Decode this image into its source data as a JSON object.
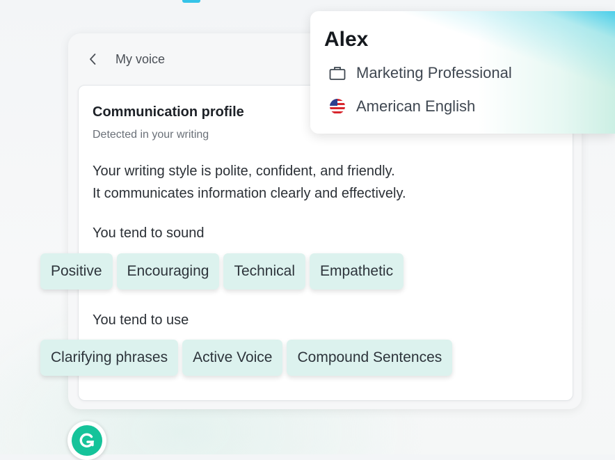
{
  "nav": {
    "back_icon": "chevron-left-icon",
    "back_label": "My voice"
  },
  "profile": {
    "title": "Communication profile",
    "subtitle": "Detected in your writing",
    "description_line1": "Your writing style is polite, confident, and friendly.",
    "description_line2": "It communicates information clearly and effectively."
  },
  "tones": {
    "label": "You tend to sound",
    "chips": [
      "Positive",
      "Encouraging",
      "Technical",
      "Empathetic"
    ]
  },
  "usage": {
    "label": "You tend to use",
    "chips": [
      "Clarifying phrases",
      "Active Voice",
      "Compound Sentences"
    ]
  },
  "user_card": {
    "name": "Alex",
    "role": "Marketing Professional",
    "role_icon": "briefcase-icon",
    "language": "American English",
    "language_icon": "us-flag-icon"
  },
  "brand": {
    "logo_icon": "grammarly-logo-icon",
    "accent_color": "#15c39a",
    "chip_color": "#dcf2ee"
  }
}
